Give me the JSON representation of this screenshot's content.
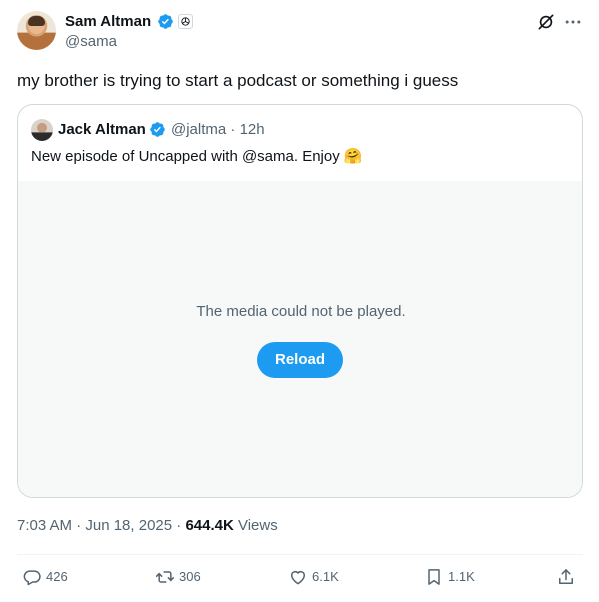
{
  "author": {
    "name": "Sam Altman",
    "handle": "@sama"
  },
  "tweet": {
    "text": "my brother is trying to start a podcast or something i guess"
  },
  "quote": {
    "name": "Jack Altman",
    "handle_time": "@jaltma · 12h",
    "text": "New episode of Uncapped with @sama. Enjoy",
    "emoji": "🤗",
    "media_message": "The media could not be played.",
    "reload_label": "Reload"
  },
  "meta": {
    "timestamp": "7:03 AM · Jun 18, 2025 · ",
    "views_count": "644.4K",
    "views_label": " Views"
  },
  "actions": {
    "replies": "426",
    "reposts": "306",
    "likes": "6.1K",
    "bookmarks": "1.1K"
  },
  "colors": {
    "accent": "#1d9bf0",
    "text_secondary": "#536471",
    "border": "#cfd9de",
    "media_bg": "#f7f9f9"
  },
  "icons": {
    "verified": "verified-badge-icon",
    "affiliate": "openai-affiliate-icon",
    "grok": "grok-icon",
    "more": "more-dots-icon",
    "reply": "reply-icon",
    "repost": "repost-icon",
    "like": "heart-icon",
    "bookmark": "bookmark-icon",
    "share": "share-icon"
  }
}
